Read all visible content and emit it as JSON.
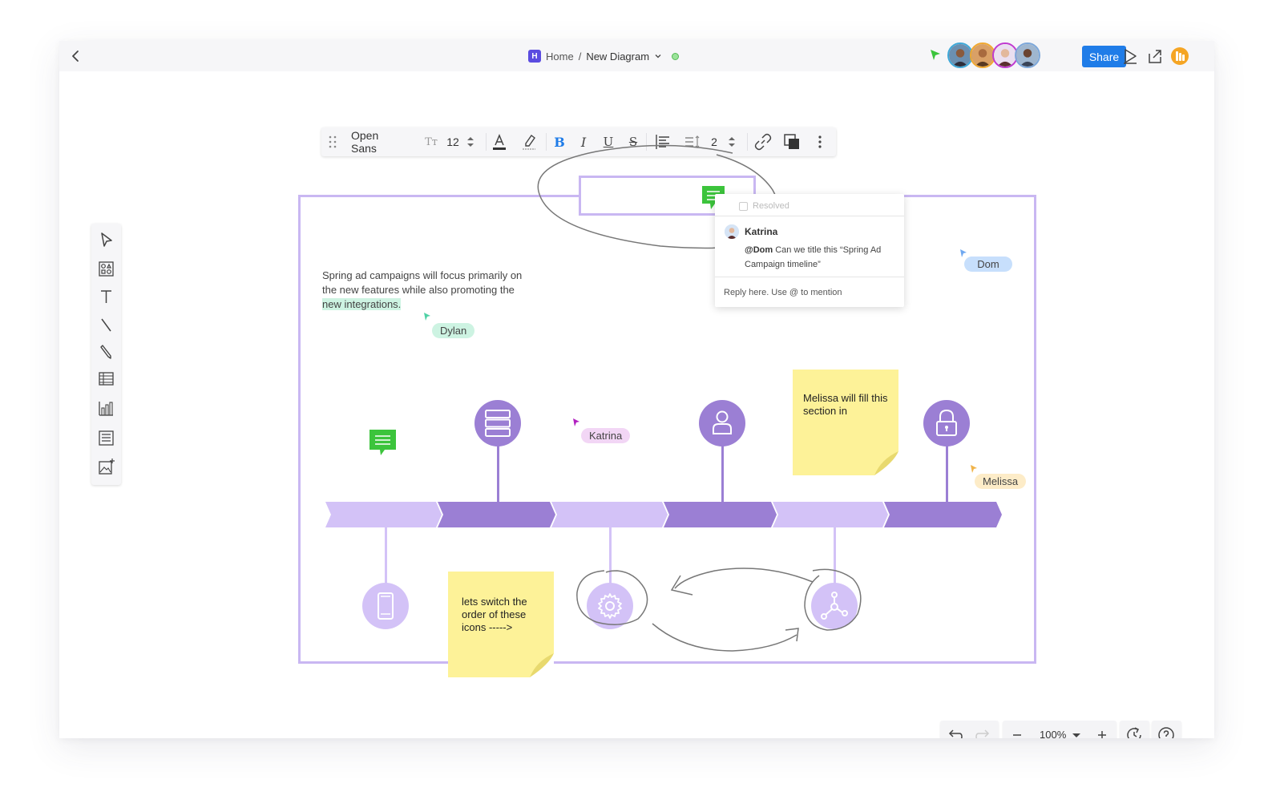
{
  "header": {
    "logo_letter": "H",
    "breadcrumb_home": "Home",
    "breadcrumb_sep": "/",
    "doc_title": "New Diagram",
    "share_label": "Share"
  },
  "format_toolbar": {
    "font_family": "Open Sans",
    "font_size": "12",
    "line_spacing": "2"
  },
  "canvas": {
    "body_text_line1": "Spring ad campaigns will focus primarily on",
    "body_text_line2": "the new features while also promoting the",
    "body_text_highlight": "new integrations.",
    "cursors": {
      "dylan": "Dylan",
      "katrina": "Katrina",
      "dom": "Dom",
      "melissa": "Melissa"
    },
    "sticky_melissa": "Melissa will fill this section in",
    "sticky_switch": "lets switch the order of these icons ----->"
  },
  "comment": {
    "resolved_label": "Resolved",
    "author": "Katrina",
    "mention": "@Dom",
    "text": " Can we title this “Spring Ad Campaign timeline”",
    "reply_placeholder": "Reply here. Use @ to mention"
  },
  "bottom_controls": {
    "zoom": "100%"
  },
  "colors": {
    "accent_purple_dark": "#9b7fd4",
    "accent_purple_light": "#d3c2f7",
    "frame_border": "#c9b7f2",
    "sticky_yellow": "#fdf298",
    "share_blue": "#1f7ce8",
    "comment_green": "#3cc43c"
  },
  "icons": {
    "back": "chevron-left-icon",
    "presence": "cursor-icon",
    "present": "play-icon",
    "export": "export-icon",
    "apps": "apps-icon",
    "comment_marker": "comment-icon",
    "timeline_top": [
      "database-icon",
      "user-icon",
      "lock-icon"
    ],
    "timeline_bottom": [
      "tablet-icon",
      "gear-icon",
      "network-icon"
    ]
  }
}
